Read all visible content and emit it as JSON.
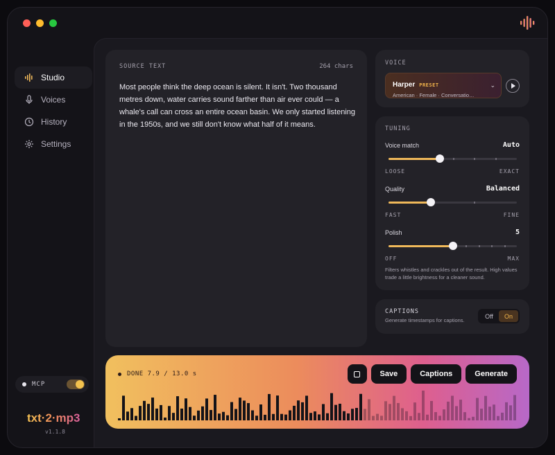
{
  "app": {
    "logo": "txt·2·mp3",
    "version": "v1.1.8"
  },
  "sidebar": {
    "items": [
      {
        "label": "Studio",
        "icon": "waveform-icon",
        "active": true
      },
      {
        "label": "Voices",
        "icon": "microphone-icon",
        "active": false
      },
      {
        "label": "History",
        "icon": "clock-icon",
        "active": false
      },
      {
        "label": "Settings",
        "icon": "gear-icon",
        "active": false
      }
    ],
    "mcp": {
      "label": "MCP",
      "enabled": true
    }
  },
  "source": {
    "label": "SOURCE TEXT",
    "count": "264 chars",
    "text": "Most people think the deep ocean is silent. It isn't. Two thousand metres down, water carries sound farther than air ever could — a whale's call can cross an entire ocean basin. We only started listening in the 1950s, and we still don't know what half of it means."
  },
  "voice": {
    "label": "VOICE",
    "name": "Harper",
    "badge": "PRESET",
    "description": "American · Female · Conversatio…"
  },
  "tuning": {
    "label": "TUNING",
    "voice_match": {
      "title": "Voice match",
      "value": "Auto",
      "level": 0.4,
      "min": "LOOSE",
      "max": "EXACT"
    },
    "quality": {
      "title": "Quality",
      "value": "Balanced",
      "level": 0.33,
      "min": "FAST",
      "max": "FINE"
    },
    "polish": {
      "title": "Polish",
      "value": "5",
      "level": 0.5,
      "min": "OFF",
      "max": "MAX"
    },
    "note": "Filters whistles and crackles out of the result. High values trade a little brightness for a cleaner sound."
  },
  "captions": {
    "title": "CAPTIONS",
    "subtitle": "Generate timestamps for captions.",
    "off": "Off",
    "on": "On",
    "selected": "On"
  },
  "player": {
    "status": "DONE 7.9 / 13.0 s",
    "progress": 0.61,
    "save": "Save",
    "captions": "Captions",
    "generate": "Generate"
  },
  "colors": {
    "accent": "#f0b95a",
    "gradient_start": "#f1c05e",
    "gradient_end": "#b768c8"
  }
}
